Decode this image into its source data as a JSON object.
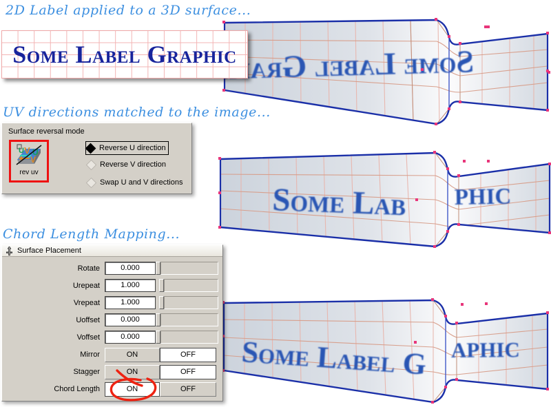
{
  "captions": {
    "c1": "2D Label applied to a 3D surface...",
    "c2": "UV directions matched to the image...",
    "c3": "Chord Length Mapping..."
  },
  "label_graphic": {
    "text": "Some Label Graphic",
    "grid_color": "#f3b4b4",
    "text_color": "#18249c",
    "background": "#ffffff"
  },
  "surface_reversal_panel": {
    "title": "Surface reversal mode",
    "tool_button": {
      "caption": "rev uv",
      "icon": "rev-uv-icon",
      "highlight_color": "#ee1111"
    },
    "options": [
      {
        "label": "Reverse U direction",
        "selected": true,
        "focused": true
      },
      {
        "label": "Reverse V direction",
        "selected": false,
        "focused": false
      },
      {
        "label": "Swap U and V directions",
        "selected": false,
        "focused": false
      }
    ]
  },
  "surface_placement_dialog": {
    "title": "Surface Placement",
    "title_icon": "pin-icon",
    "numeric_fields": [
      {
        "label": "Rotate",
        "value": "0.000"
      },
      {
        "label": "Urepeat",
        "value": "1.000"
      },
      {
        "label": "Vrepeat",
        "value": "1.000"
      },
      {
        "label": "Uoffset",
        "value": "0.000"
      },
      {
        "label": "Voffset",
        "value": "0.000"
      }
    ],
    "toggle_fields": [
      {
        "label": "Mirror",
        "on": "ON",
        "off": "OFF",
        "selected": "OFF",
        "annotated": false
      },
      {
        "label": "Stagger",
        "on": "ON",
        "off": "OFF",
        "selected": "OFF",
        "annotated": false
      },
      {
        "label": "Chord Length",
        "on": "ON",
        "off": "OFF",
        "selected": "ON",
        "annotated": true
      }
    ],
    "annotation": {
      "shape": "red-circle-ellipse",
      "color": "#ee2211",
      "target": "Chord Length ON"
    }
  },
  "viewport": {
    "surfaces": [
      {
        "name": "surface-reversed",
        "mapped_text": "SOME LABEL GRAPHIC",
        "rendered_text": "DIHЧAЯƆ ⅃ƎᙠA⅃ ƎMOƧ",
        "mirrored": true,
        "chord_length": false,
        "caption_ref": "c1"
      },
      {
        "name": "surface-uv-matched",
        "mapped_text": "SOME LABEL GRAPHIC",
        "mirrored": false,
        "chord_length": false,
        "caption_ref": "c2"
      },
      {
        "name": "surface-chord-length",
        "mapped_text": "SOME LABEL GRAPHIC",
        "mirrored": false,
        "chord_length": true,
        "caption_ref": "c3"
      }
    ],
    "colors": {
      "surface_fill_light": "#f2f2f4",
      "surface_fill_dark": "#c6cdd6",
      "edge_curve": "#1a2fa8",
      "isoparm": "#cf9a86",
      "control_point": "#e8357a",
      "text_on_surface": "#2a57b4"
    }
  }
}
